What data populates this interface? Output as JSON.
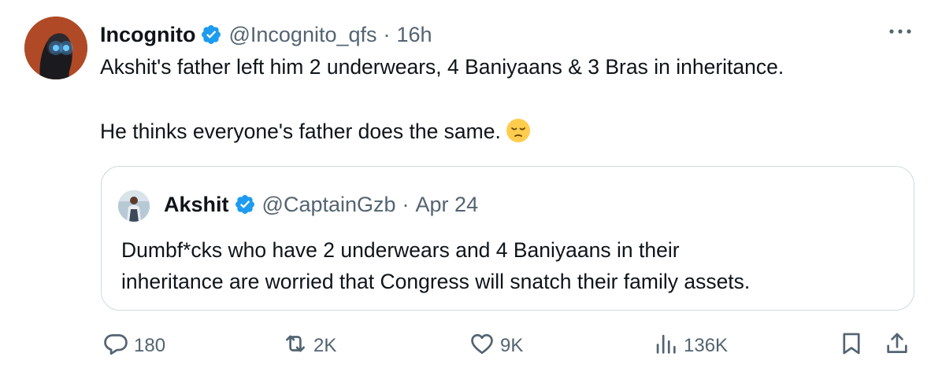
{
  "tweet": {
    "author_name": "Incognito",
    "author_handle": "@Incognito_qfs",
    "separator": "·",
    "time": "16h",
    "text_line1": "Akshit's father left him 2 underwears, 4 Baniyaans & 3 Bras in inheritance.",
    "text_line2": "He thinks everyone's father does the same.",
    "emoji": "pensive-face"
  },
  "quoted": {
    "author_name": "Akshit",
    "author_handle": "@CaptainGzb",
    "separator": "·",
    "date": "Apr 24",
    "text_line1": "Dumbf*cks who have 2 underwears and 4 Baniyaans in their",
    "text_line2": "inheritance are worried that Congress will snatch their family assets."
  },
  "actions": {
    "replies": "180",
    "reposts": "2K",
    "likes": "9K",
    "views": "136K"
  },
  "icons": {
    "verified": "verified-badge-icon",
    "more": "more-icon",
    "reply": "reply-icon",
    "repost": "repost-icon",
    "like": "heart-icon",
    "views": "views-icon",
    "bookmark": "bookmark-icon",
    "share": "share-icon"
  },
  "colors": {
    "verified_blue": "#1d9bf0",
    "secondary_text": "#536471",
    "border": "#cfd9de"
  }
}
